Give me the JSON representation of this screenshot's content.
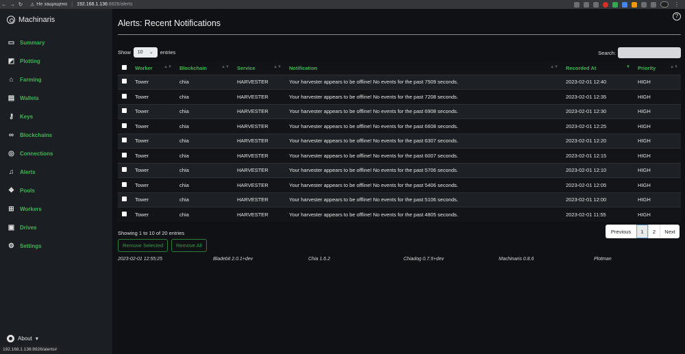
{
  "browser": {
    "security_label": "Не защищено",
    "url_host": "192.168.1.136",
    "url_path": ":8926/alerts"
  },
  "sidebar": {
    "brand": "Machinaris",
    "items": [
      {
        "label": "Summary",
        "icon": "summary-icon"
      },
      {
        "label": "Plotting",
        "icon": "plotting-icon"
      },
      {
        "label": "Farming",
        "icon": "farming-icon"
      },
      {
        "label": "Wallets",
        "icon": "wallet-icon"
      },
      {
        "label": "Keys",
        "icon": "key-icon"
      },
      {
        "label": "Blockchains",
        "icon": "link-icon"
      },
      {
        "label": "Connections",
        "icon": "connections-icon"
      },
      {
        "label": "Alerts",
        "icon": "bell-icon"
      },
      {
        "label": "Pools",
        "icon": "pools-icon"
      },
      {
        "label": "Workers",
        "icon": "workers-icon"
      },
      {
        "label": "Drives",
        "icon": "drives-icon"
      },
      {
        "label": "Settings",
        "icon": "gear-icon"
      }
    ],
    "about_label": "About",
    "status_url": "192.168.1.136:8926/alerts#"
  },
  "main": {
    "title": "Alerts: Recent Notifications",
    "show_label": "Show",
    "entries_label": "entries",
    "entries_value": "10",
    "search_label": "Search:",
    "search_value": "",
    "columns": [
      "Worker",
      "Blockchain",
      "Service",
      "Notification",
      "Recorded At",
      "Priority"
    ],
    "rows": [
      {
        "worker": "Tower",
        "blockchain": "chia",
        "service": "HARVESTER",
        "notification": "Your harvester appears to be offline! No events for the past 7509 seconds.",
        "recorded_at": "2023-02-01 12:40",
        "priority": "HIGH"
      },
      {
        "worker": "Tower",
        "blockchain": "chia",
        "service": "HARVESTER",
        "notification": "Your harvester appears to be offline! No events for the past 7208 seconds.",
        "recorded_at": "2023-02-01 12:35",
        "priority": "HIGH"
      },
      {
        "worker": "Tower",
        "blockchain": "chia",
        "service": "HARVESTER",
        "notification": "Your harvester appears to be offline! No events for the past 6908 seconds.",
        "recorded_at": "2023-02-01 12:30",
        "priority": "HIGH"
      },
      {
        "worker": "Tower",
        "blockchain": "chia",
        "service": "HARVESTER",
        "notification": "Your harvester appears to be offline! No events for the past 6608 seconds.",
        "recorded_at": "2023-02-01 12:25",
        "priority": "HIGH"
      },
      {
        "worker": "Tower",
        "blockchain": "chia",
        "service": "HARVESTER",
        "notification": "Your harvester appears to be offline! No events for the past 6307 seconds.",
        "recorded_at": "2023-02-01 12:20",
        "priority": "HIGH"
      },
      {
        "worker": "Tower",
        "blockchain": "chia",
        "service": "HARVESTER",
        "notification": "Your harvester appears to be offline! No events for the past 6007 seconds.",
        "recorded_at": "2023-02-01 12:15",
        "priority": "HIGH"
      },
      {
        "worker": "Tower",
        "blockchain": "chia",
        "service": "HARVESTER",
        "notification": "Your harvester appears to be offline! No events for the past 5706 seconds.",
        "recorded_at": "2023-02-01 12:10",
        "priority": "HIGH"
      },
      {
        "worker": "Tower",
        "blockchain": "chia",
        "service": "HARVESTER",
        "notification": "Your harvester appears to be offline! No events for the past 5406 seconds.",
        "recorded_at": "2023-02-01 12:05",
        "priority": "HIGH"
      },
      {
        "worker": "Tower",
        "blockchain": "chia",
        "service": "HARVESTER",
        "notification": "Your harvester appears to be offline! No events for the past 5106 seconds.",
        "recorded_at": "2023-02-01 12:00",
        "priority": "HIGH"
      },
      {
        "worker": "Tower",
        "blockchain": "chia",
        "service": "HARVESTER",
        "notification": "Your harvester appears to be offline! No events for the past 4805 seconds.",
        "recorded_at": "2023-02-01 11:55",
        "priority": "HIGH"
      }
    ],
    "info_text": "Showing 1 to 10 of 20 entries",
    "remove_selected_label": "Remove Selected",
    "remove_all_label": "Remove All",
    "pager": {
      "previous": "Previous",
      "pages": [
        "1",
        "2"
      ],
      "next": "Next"
    }
  },
  "footer": {
    "timestamp": "2023-02-01 12:55:25",
    "bladebit": "Bladebit 2.0.1+dev",
    "chia": "Chia 1.6.2",
    "chiadog": "Chiadog 0.7.5+dev",
    "machinaris": "Machinaris 0.8.6",
    "plotman": "Plotman"
  },
  "colors": {
    "accent_green": "#3fb653",
    "sidebar_bg": "#1b1e22",
    "main_bg": "#0f1114"
  }
}
